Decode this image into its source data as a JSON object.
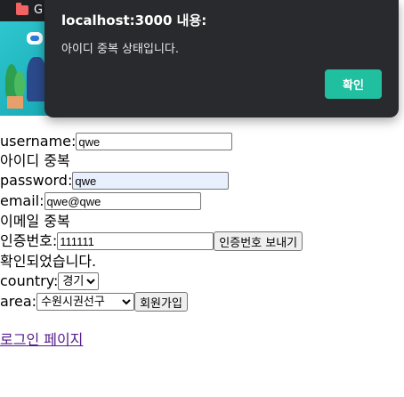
{
  "browser": {
    "tab_label": "G"
  },
  "dialog": {
    "title": "localhost:3000 내용:",
    "message": "아이디 중복 상태입니다.",
    "ok_label": "확인",
    "ok_color": "#1fbfa0"
  },
  "form": {
    "username": {
      "label": "username:",
      "value": "qwe"
    },
    "username_status": "아이디 중복",
    "password": {
      "label": "password:",
      "value": "qwe"
    },
    "email": {
      "label": "email:",
      "value": "qwe@qwe"
    },
    "email_status": "이메일 중복",
    "auth": {
      "label": "인증번호:",
      "value": "111111",
      "send_label": "인증번호 보내기"
    },
    "auth_status": "확인되었습니다.",
    "country": {
      "label": "country:",
      "selected": "경기"
    },
    "area": {
      "label": "area:",
      "selected": "수원시권선구"
    },
    "signup_label": "회원가입",
    "login_link": "로그인 페이지"
  }
}
